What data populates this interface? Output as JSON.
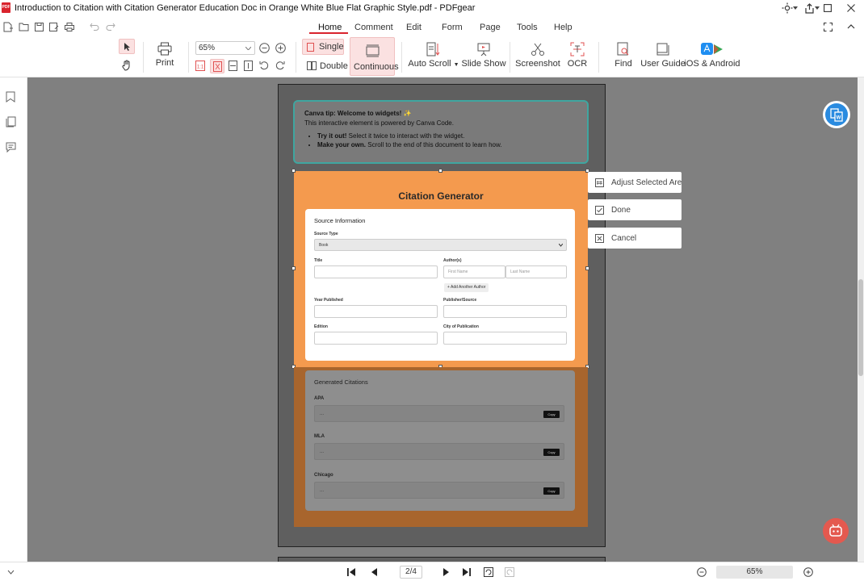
{
  "window": {
    "title": "Introduction to Citation with Citation Generator Education Doc in Orange White Blue Flat Graphic Style.pdf - PDFgear",
    "logo_text": "PDF"
  },
  "menu": {
    "items": [
      "Home",
      "Comment",
      "Edit",
      "Form",
      "Page",
      "Tools",
      "Help"
    ],
    "active": "Home"
  },
  "toolbar": {
    "print": "Print",
    "zoom_value": "65%",
    "single": "Single",
    "double": "Double",
    "continuous": "Continuous",
    "auto_scroll": "Auto Scroll",
    "slide_show": "Slide Show",
    "screenshot": "Screenshot",
    "ocr": "OCR",
    "find": "Find",
    "user_guide": "User Guide",
    "ios_android": "iOS & Android"
  },
  "document": {
    "tip": {
      "heading": "Canva tip: Welcome to widgets! ✨",
      "line": "This interactive element is powered by Canva Code.",
      "bullet1_bold": "Try it out!",
      "bullet1_rest": " Select it twice to interact with the widget.",
      "bullet2_bold": "Make your own.",
      "bullet2_rest": " Scroll to the end of this document to learn how."
    },
    "widget": {
      "title": "Citation Generator",
      "section": "Source Information",
      "source_type_label": "Source Type",
      "source_type_value": "Book",
      "title_label": "Title",
      "authors_label": "Author(s)",
      "first_name_placeholder": "First Name",
      "last_name_placeholder": "Last Name",
      "add_author": "+ Add Another Author",
      "year_label": "Year Published",
      "publisher_label": "Publisher/Source",
      "edition_label": "Edition",
      "city_label": "City of Publication"
    },
    "generated": {
      "heading": "Generated Citations",
      "styles": [
        "APA",
        "MLA",
        "Chicago"
      ],
      "placeholder": "...",
      "copy": "Copy"
    }
  },
  "context_menu": {
    "adjust": "Adjust Selected Area",
    "done": "Done",
    "cancel": "Cancel"
  },
  "pagination": {
    "current": "2/4"
  },
  "zoom": {
    "value": "65%"
  },
  "colors": {
    "brand_red": "#d9232d",
    "widget_orange": "#f49a4e",
    "canvas_gray": "#808080",
    "tip_border": "#3fa6a0"
  }
}
